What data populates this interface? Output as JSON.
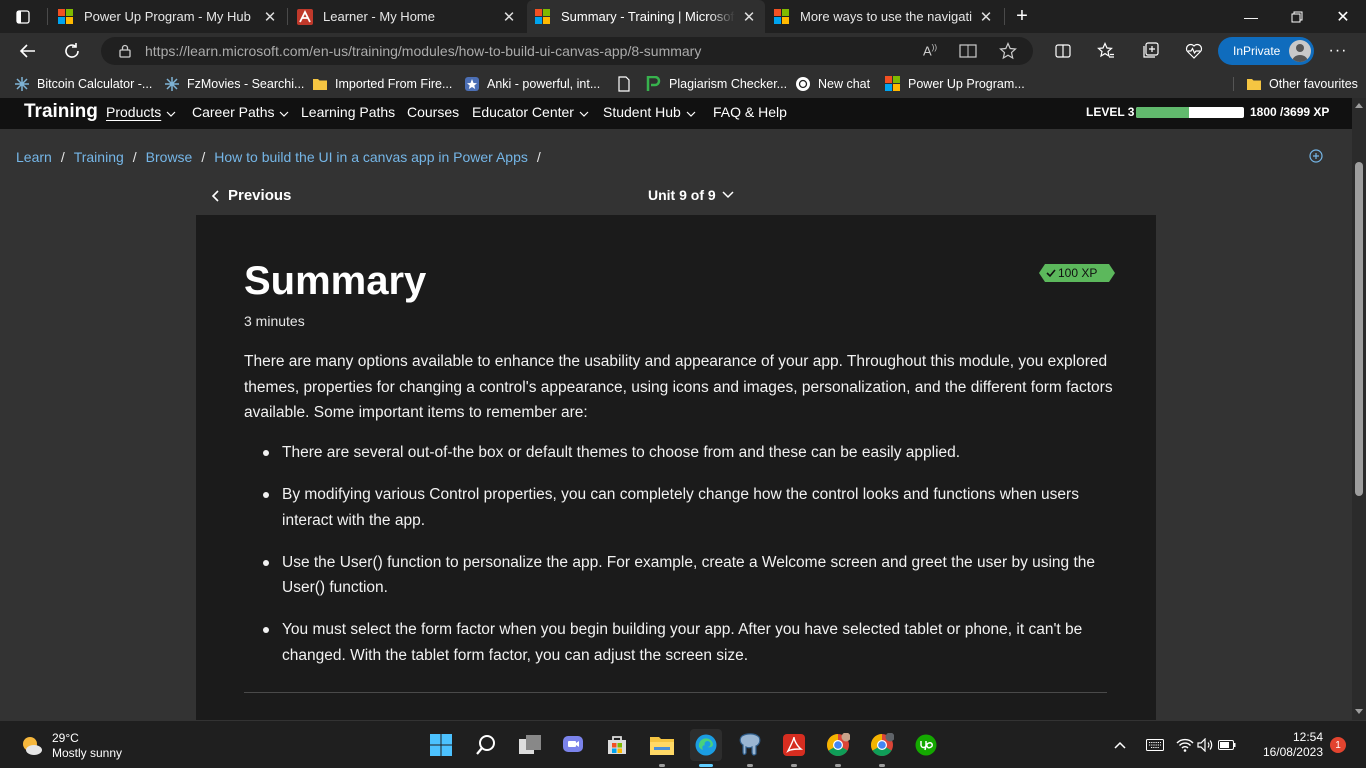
{
  "browser": {
    "tabs": [
      {
        "title": "Power Up Program - My Hub",
        "active": false
      },
      {
        "title": "Learner - My Home",
        "active": false
      },
      {
        "title": "Summary - Training | Microsoft Learn",
        "active": true
      },
      {
        "title": "More ways to use the navigation",
        "active": false
      }
    ],
    "url_host": "https://learn.microsoft.com",
    "url_path": "/en-us/training/modules/how-to-build-ui-canvas-app/8-summary",
    "inprivate_label": "InPrivate",
    "bookmarks": [
      "Bitcoin Calculator -...",
      "FzMovies - Searchi...",
      "Imported From Fire...",
      "Anki - powerful, int...",
      "",
      "Plagiarism Checker...",
      "New chat",
      "Power Up Program..."
    ],
    "other_favourites": "Other favourites"
  },
  "site": {
    "brand": "Training",
    "nav": [
      "Products",
      "Career Paths",
      "Learning Paths",
      "Courses",
      "Educator Center",
      "Student Hub",
      "FAQ & Help"
    ],
    "level_label": "LEVEL 3",
    "xp_current": 1800,
    "xp_total": 3699,
    "xp_text": "1800 /3699 XP",
    "breadcrumbs": [
      "Learn",
      "Training",
      "Browse",
      "How to build the UI in a canvas app in Power Apps"
    ]
  },
  "unit_nav": {
    "previous": "Previous",
    "unit_label": "Unit 9 of 9"
  },
  "content": {
    "title": "Summary",
    "duration": "3 minutes",
    "xp_badge": "100 XP",
    "intro": "There are many options available to enhance the usability and appearance of your app. Throughout this module, you explored themes, properties for changing a control's appearance, using icons and images, personalization, and the different form factors available. Some important items to remember are:",
    "bullets": [
      "There are several out-of-the box or default themes to choose from and these can be easily applied.",
      "By modifying various Control properties, you can completely change how the control looks and functions when users interact with the app.",
      "Use the User() function to personalize the app. For example, create a Welcome screen and greet the user by using the User() function.",
      "You must select the form factor when you begin building your app. After you have selected tablet or phone, it can't be changed. With the tablet form factor, you can adjust the screen size."
    ]
  },
  "taskbar": {
    "temperature": "29°C",
    "condition": "Mostly sunny",
    "time": "12:54",
    "date": "16/08/2023",
    "notifications": "1"
  },
  "colors": {
    "accent_link": "#75b6e7",
    "xp_green": "#61b96d",
    "inprivate_blue": "#0f6cbd"
  }
}
